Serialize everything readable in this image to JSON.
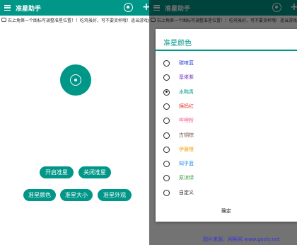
{
  "app_title": "准星助手",
  "tip_text": "右上角第一个图标可调整准星位置！！吃鸡虽好，可不要贪杯哦！适当游戏益脑，沉迷游戏伤身",
  "buttons": {
    "open": "开启准星",
    "close": "关闭准星",
    "color": "准星颜色",
    "size": "准星大小",
    "look": "准星外观"
  },
  "dialog": {
    "title": "准星颜色",
    "options": [
      {
        "label": "碳喳蓝",
        "color": "#2e49d8",
        "selected": false
      },
      {
        "label": "基佬紫",
        "color": "#7a3fb8",
        "selected": false
      },
      {
        "label": "水鸭青",
        "color": "#009688",
        "selected": true
      },
      {
        "label": "姨妈红",
        "color": "#e23a2a",
        "selected": false
      },
      {
        "label": "哔哩粉",
        "color": "#f06292",
        "selected": false
      },
      {
        "label": "古铜棕",
        "color": "#795548",
        "selected": false
      },
      {
        "label": "伊藤橙",
        "color": "#f4a000",
        "selected": false
      },
      {
        "label": "知乎蓝",
        "color": "#1e88e5",
        "selected": false
      },
      {
        "label": "原谅绿",
        "color": "#43a047",
        "selected": false
      },
      {
        "label": "自定义",
        "color": "#222222",
        "selected": false
      }
    ],
    "confirm": "确定"
  },
  "watermark": "图片来源：网客网 www.gooly.net",
  "colors": {
    "primary": "#009688"
  }
}
